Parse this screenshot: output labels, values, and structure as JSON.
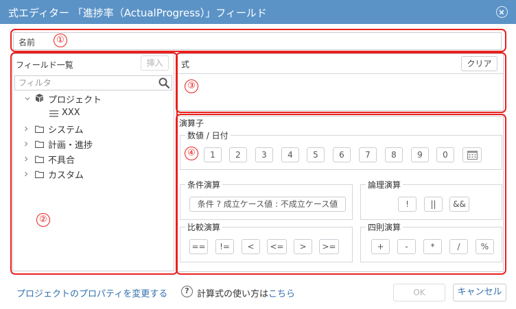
{
  "dialog": {
    "title": "式エディター 「進捗率（ActualProgress）」フィールド"
  },
  "badges": [
    "①",
    "②",
    "③",
    "④"
  ],
  "name_field": {
    "label": "名前",
    "value": ""
  },
  "field_list": {
    "title": "フィールド一覧",
    "insert_label": "挿入",
    "filter_placeholder": "フィルタ",
    "tree": [
      {
        "label": "プロジェクト",
        "icon": "project-icon",
        "expanded": true
      },
      {
        "label": "XXX",
        "icon": "list-icon",
        "child": true
      },
      {
        "label": "システム",
        "icon": "folder-icon"
      },
      {
        "label": "計画・進捗",
        "icon": "folder-icon"
      },
      {
        "label": "不具合",
        "icon": "folder-icon"
      },
      {
        "label": "カスタム",
        "icon": "folder-icon"
      }
    ]
  },
  "formula": {
    "title": "式",
    "clear_label": "クリア",
    "value": ""
  },
  "operators": {
    "title": "演算子",
    "numeric": {
      "title": "数値 / 日付",
      "keys": [
        "1",
        "2",
        "3",
        "4",
        "5",
        "6",
        "7",
        "8",
        "9",
        "0"
      ]
    },
    "conditional": {
      "title": "条件演算",
      "keys": [
        "条件 ? 成立ケース値 : 不成立ケース値"
      ]
    },
    "logical": {
      "title": "論理演算",
      "keys": [
        "!",
        "||",
        "&&"
      ]
    },
    "comparison": {
      "title": "比較演算",
      "keys": [
        "==",
        "!=",
        "<",
        "<=",
        ">",
        ">="
      ]
    },
    "arithmetic": {
      "title": "四則演算",
      "keys": [
        "+",
        "-",
        "*",
        "/",
        "%"
      ]
    }
  },
  "footer": {
    "change_props_link": "プロジェクトのプロパティを変更する",
    "help_text": "計算式の使い方は",
    "help_link": "こちら",
    "ok_label": "OK",
    "cancel_label": "キャンセル"
  },
  "colors": {
    "titlebar": "#5b93c7",
    "annotation_red": "#e8201e",
    "link_blue": "#2f6fad"
  }
}
